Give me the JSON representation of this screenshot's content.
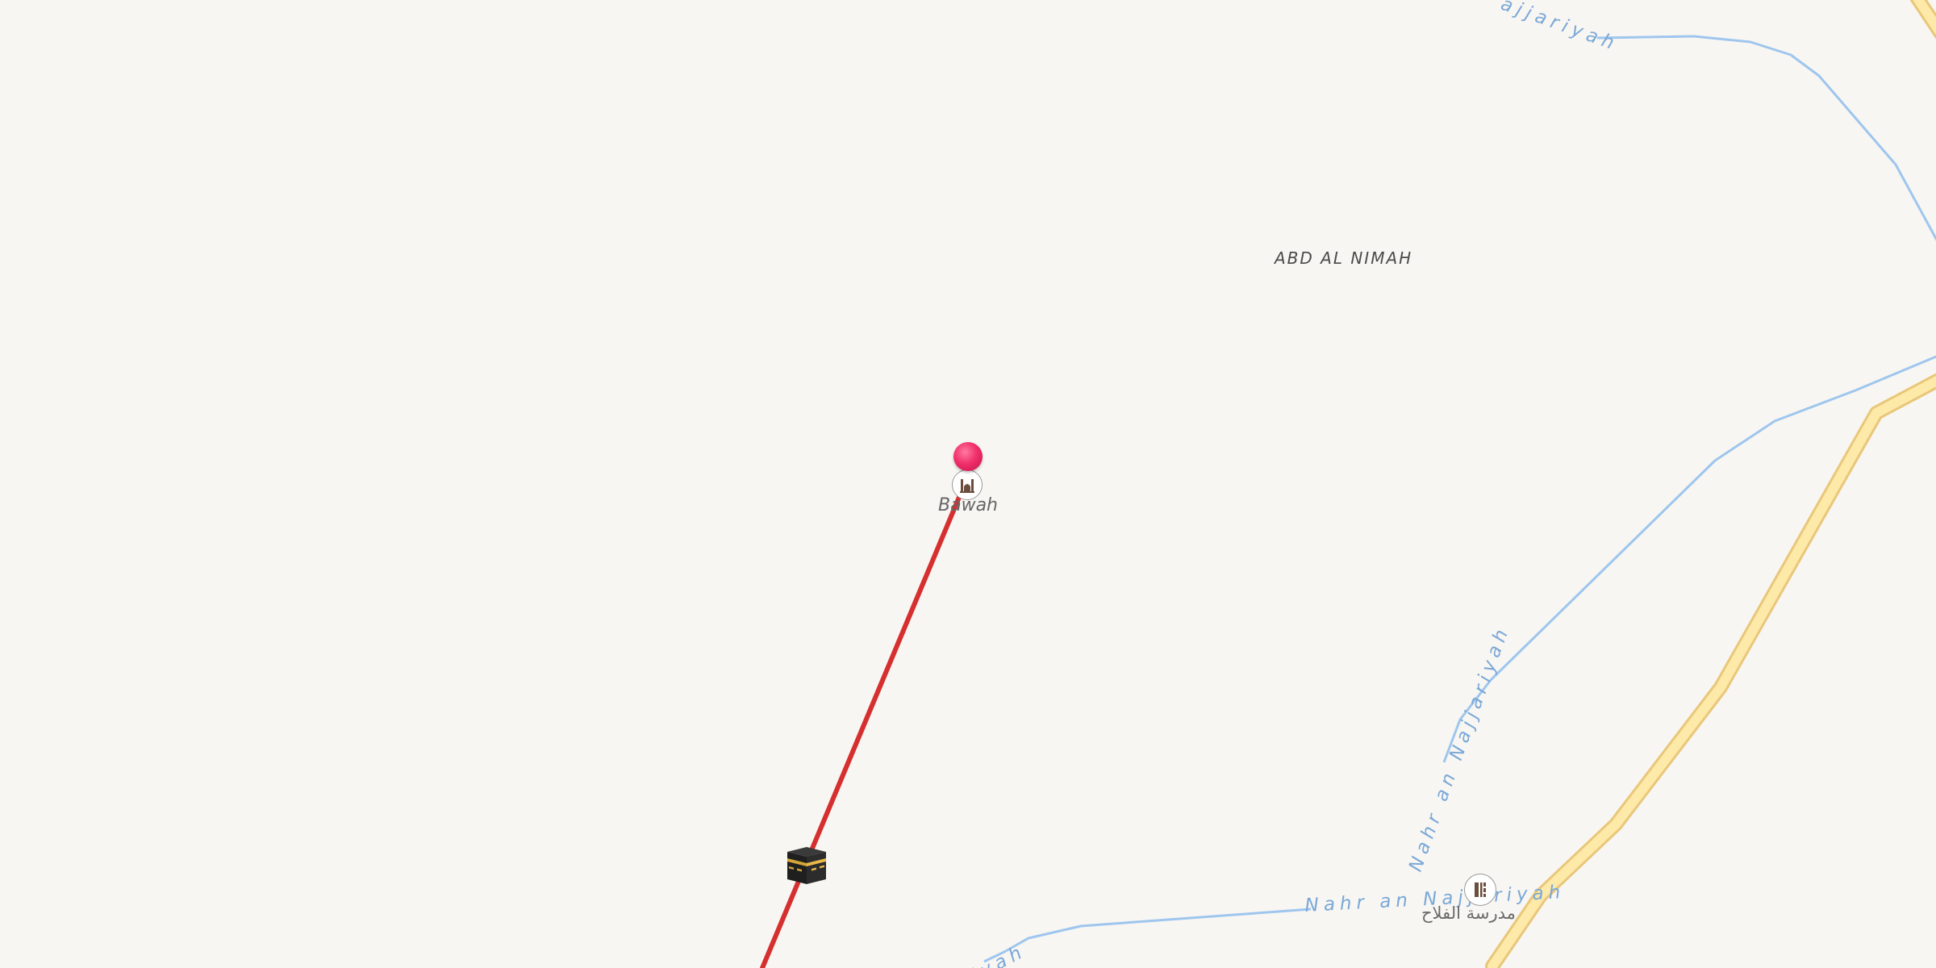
{
  "map": {
    "region_label": "ABD AL NIMAH",
    "place_label": "Bawah",
    "school_label": "مدرسة الفلاح",
    "river_labels": [
      "ajjariyah",
      "Nahr an Najjariyah",
      "Nahr an Najjariyah",
      "iyah"
    ],
    "colors": {
      "background": "#f8f6f2",
      "route_line": "#d62f2f",
      "river": "#9ec6ee",
      "road_fill": "#fde9a8",
      "road_casing": "#e9c77a",
      "pin": "#f0306a"
    },
    "icons": {
      "pin": "location-pin-icon",
      "mosque": "mosque-icon",
      "school": "school-icon",
      "destination": "kaaba-icon"
    }
  }
}
